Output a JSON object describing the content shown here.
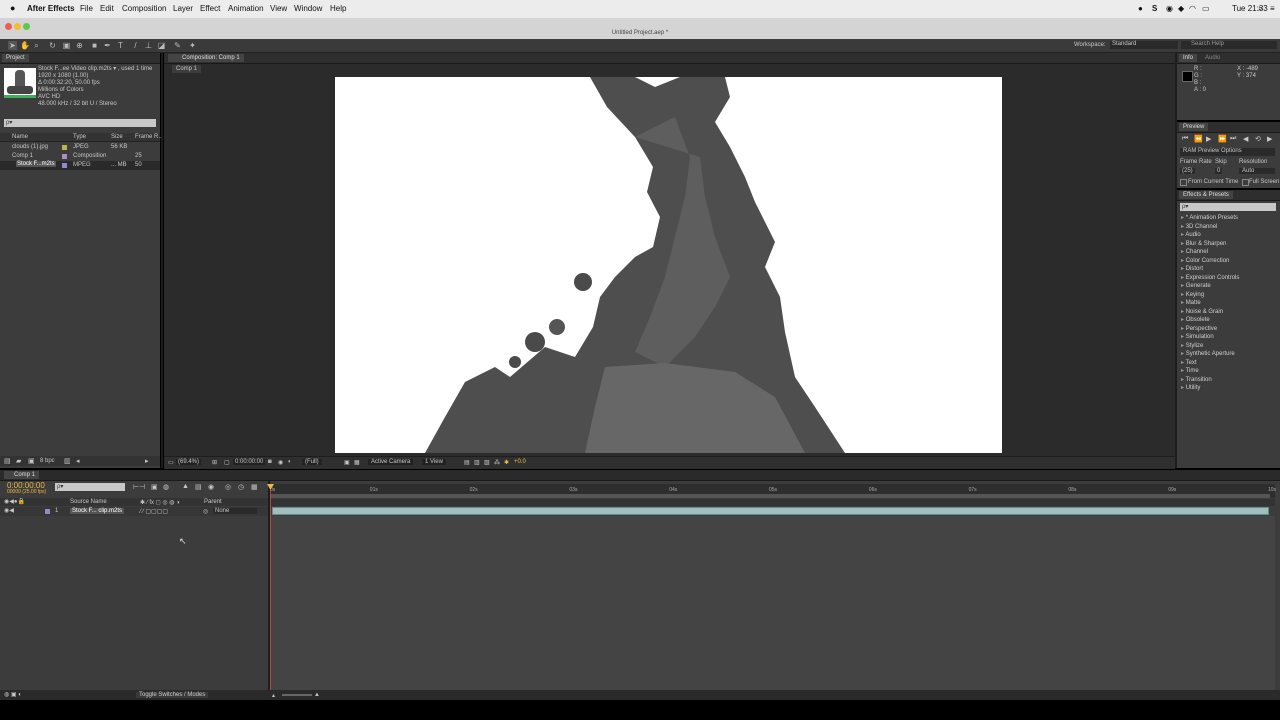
{
  "os_menubar": {
    "app_name": "After Effects",
    "menus": [
      "File",
      "Edit",
      "Composition",
      "Layer",
      "Effect",
      "Animation",
      "View",
      "Window",
      "Help"
    ],
    "clock": "Tue 21:33"
  },
  "window": {
    "title": "Untitled Project.aep *"
  },
  "workspace": {
    "label": "Workspace:",
    "value": "Standard",
    "search_placeholder": "Search Help"
  },
  "project_panel": {
    "tab": "Project",
    "selected": {
      "name": "Stock F...ee Video clip.m2ts ▾ , used 1 time",
      "dims": "1920 x 1080 (1.00)",
      "duration": "Δ 0:00:32:20, 50.00 fps",
      "colors": "Millions of Colors",
      "codec": "AVC HD",
      "audio": "48.000 kHz / 32 bit U / Stereo"
    },
    "search_placeholder": "ρ▾",
    "columns": [
      "Name",
      "Type",
      "Size",
      "Frame R..."
    ],
    "items": [
      {
        "name": "clouds (1).jpg",
        "type": "JPEG",
        "size": "56 KB",
        "rate": "",
        "color": "#b8b84a"
      },
      {
        "name": "Comp 1",
        "type": "Composition",
        "size": "",
        "rate": "25",
        "color": "#a98fbf"
      },
      {
        "name": "Stock F...m2ts",
        "type": "MPEG",
        "size": "... MB",
        "rate": "50",
        "color": "#8b8bd0"
      }
    ],
    "bpc": "8 bpc"
  },
  "composition_panel": {
    "tab": "Composition: Comp 1",
    "breadcrumb": "Comp 1",
    "zoom": "(69.4%)",
    "timecode": "0:00:00:00",
    "resolution": "(Full)",
    "camera": "Active Camera",
    "views": "1 View",
    "exposure": "+0.0"
  },
  "info_panel": {
    "tabs": [
      "Info",
      "Audio"
    ],
    "r": "R :",
    "g": "G :",
    "b": "B :",
    "a": "A : 0",
    "x": "X : -489",
    "y": "Y : 374"
  },
  "preview_panel": {
    "tab": "Preview",
    "ram_options": "RAM Preview Options",
    "frame_rate_label": "Frame Rate",
    "skip_label": "Skip",
    "resolution_label": "Resolution",
    "frame_rate": "(25)",
    "skip": "0",
    "resolution": "Auto",
    "from_current": "From Current Time",
    "full_screen": "Full Screen"
  },
  "effects_panel": {
    "tab": "Effects & Presets",
    "search_placeholder": "ρ▾",
    "items": [
      "* Animation Presets",
      "3D Channel",
      "Audio",
      "Blur & Sharpen",
      "Channel",
      "Color Correction",
      "Distort",
      "Expression Controls",
      "Generate",
      "Keying",
      "Matte",
      "Noise & Grain",
      "Obsolete",
      "Perspective",
      "Simulation",
      "Stylize",
      "Synthetic Aperture",
      "Text",
      "Time",
      "Transition",
      "Utility"
    ]
  },
  "timeline": {
    "tab": "Comp 1",
    "timecode": "0:00:00:00",
    "frames": "00000 (25.00 fps)",
    "search_placeholder": "ρ▾",
    "col_source": "Source Name",
    "col_parent": "Parent",
    "ruler": [
      "0s",
      "01s",
      "02s",
      "03s",
      "04s",
      "05s",
      "06s",
      "07s",
      "08s",
      "09s",
      "10s"
    ],
    "layer": {
      "index": "1",
      "name": "Stock F... clip.m2ts",
      "parent": "None"
    },
    "toggle_label": "Toggle Switches / Modes"
  }
}
